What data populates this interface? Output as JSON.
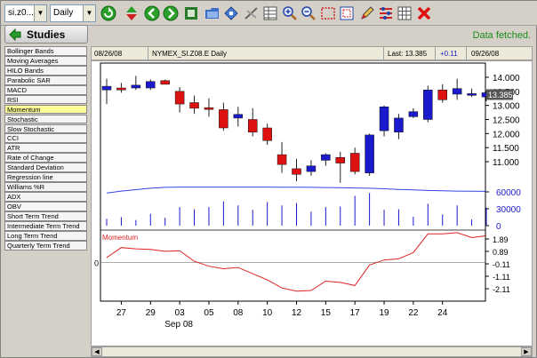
{
  "toolbar": {
    "symbol_value": "si.z0...",
    "period_value": "Daily",
    "icons": [
      "refresh-icon",
      "up-down-icon",
      "back-icon",
      "forward-icon",
      "print-icon",
      "open-folder-icon",
      "save-icon",
      "draw-line-icon",
      "table-icon",
      "zoom-in-icon",
      "zoom-out-icon",
      "select-rect-icon",
      "fit-icon",
      "pencil-icon",
      "settings-icon",
      "grid-icon",
      "delete-icon"
    ]
  },
  "status": "Data fetched.",
  "studies": {
    "button_label": "Studies",
    "items": [
      "Bollinger Bands",
      "Moving Averages",
      "HILO Bands",
      "Parabolic SAR",
      "MACD",
      "RSI",
      "Momentum",
      "Stochastic",
      "Slow Stochastic",
      "CCI",
      "ATR",
      "Rate of Change",
      "Standard Deviation",
      "Regression line",
      "Williams %R",
      "ADX",
      "OBV",
      "Short Term Trend",
      "Intermediate Term Trend",
      "Long Term Trend",
      "Quarterly Term Trend"
    ],
    "active_index": 6
  },
  "header": {
    "date_left": "08/26/08",
    "title": "NYMEX_SI.Z08.E Daily",
    "last_label": "Last: 13.385",
    "change": "+0.11",
    "date_right": "09/26/08"
  },
  "colors": {
    "up": "#1a1acc",
    "down": "#dd1111",
    "ma": "#3344dd",
    "momentum": "#dd2222",
    "status": "#1a8a1a"
  },
  "chart_data": {
    "type": "candlestick",
    "price_axis": {
      "ticks": [
        14.0,
        13.5,
        13.0,
        12.5,
        12.0,
        11.5,
        11.0
      ],
      "labels": [
        "14.000",
        "13.500",
        "13.000",
        "12.500",
        "12.000",
        "11.500",
        "11.000"
      ],
      "range": [
        10.5,
        14.4
      ]
    },
    "last_price_tag": "13.385",
    "volume_axis": {
      "ticks": [
        60000,
        30000,
        0
      ],
      "labels": [
        "60000",
        "30000",
        "0"
      ]
    },
    "momentum": {
      "label": "Momentum",
      "ticks": [
        1.89,
        0.89,
        -0.11,
        -1.11,
        -2.11
      ],
      "labels": [
        "1.89",
        "0.89",
        "-0.11",
        "-1.11",
        "-2.11"
      ],
      "zero_label": "0"
    },
    "x_labels": [
      "27",
      "29",
      "03",
      "05",
      "08",
      "10",
      "12",
      "15",
      "17",
      "19",
      "22",
      "24"
    ],
    "x_label_index": [
      1,
      3,
      5,
      7,
      9,
      11,
      13,
      15,
      17,
      19,
      21,
      23
    ],
    "month_label": "Sep 08",
    "candles": [
      {
        "o": 13.55,
        "h": 13.95,
        "l": 13.05,
        "c": 13.68
      },
      {
        "o": 13.62,
        "h": 13.8,
        "l": 13.45,
        "c": 13.55
      },
      {
        "o": 13.62,
        "h": 14.05,
        "l": 13.55,
        "c": 13.72
      },
      {
        "o": 13.62,
        "h": 13.92,
        "l": 13.55,
        "c": 13.85
      },
      {
        "o": 13.88,
        "h": 13.92,
        "l": 13.75,
        "c": 13.75
      },
      {
        "o": 13.5,
        "h": 13.65,
        "l": 12.75,
        "c": 13.05
      },
      {
        "o": 13.1,
        "h": 13.35,
        "l": 12.7,
        "c": 12.9
      },
      {
        "o": 12.92,
        "h": 13.25,
        "l": 12.6,
        "c": 12.9
      },
      {
        "o": 12.85,
        "h": 13.1,
        "l": 12.1,
        "c": 12.2
      },
      {
        "o": 12.55,
        "h": 12.95,
        "l": 12.25,
        "c": 12.68
      },
      {
        "o": 12.5,
        "h": 12.9,
        "l": 11.9,
        "c": 12.05
      },
      {
        "o": 12.2,
        "h": 12.35,
        "l": 11.6,
        "c": 11.75
      },
      {
        "o": 11.25,
        "h": 11.7,
        "l": 10.6,
        "c": 10.9
      },
      {
        "o": 10.75,
        "h": 11.1,
        "l": 10.3,
        "c": 10.55
      },
      {
        "o": 10.65,
        "h": 11.05,
        "l": 10.5,
        "c": 10.85
      },
      {
        "o": 11.05,
        "h": 11.3,
        "l": 10.85,
        "c": 11.25
      },
      {
        "o": 11.15,
        "h": 11.35,
        "l": 10.25,
        "c": 10.95
      },
      {
        "o": 11.3,
        "h": 11.5,
        "l": 10.55,
        "c": 10.65
      },
      {
        "o": 10.6,
        "h": 12.0,
        "l": 10.5,
        "c": 11.95
      },
      {
        "o": 12.1,
        "h": 13.0,
        "l": 11.9,
        "c": 12.95
      },
      {
        "o": 12.05,
        "h": 12.7,
        "l": 11.8,
        "c": 12.55
      },
      {
        "o": 12.6,
        "h": 12.9,
        "l": 12.55,
        "c": 12.78
      },
      {
        "o": 12.5,
        "h": 13.7,
        "l": 12.4,
        "c": 13.55
      },
      {
        "o": 13.55,
        "h": 13.75,
        "l": 13.1,
        "c": 13.2
      },
      {
        "o": 13.4,
        "h": 13.95,
        "l": 13.2,
        "c": 13.6
      },
      {
        "o": 13.42,
        "h": 13.6,
        "l": 13.3,
        "c": 13.42
      },
      {
        "o": 13.3,
        "h": 13.5,
        "l": 13.15,
        "c": 13.45
      }
    ],
    "moving_average": [
      58000,
      61500,
      64000,
      66500,
      68000,
      68500,
      68500,
      68500,
      68500,
      68500,
      68500,
      68500,
      68400,
      68200,
      68000,
      67800,
      67500,
      67000,
      66500,
      65500,
      64500,
      63500,
      62500,
      62000,
      61500,
      61200,
      61000
    ],
    "volume": [
      12000,
      15000,
      10000,
      21000,
      14000,
      33000,
      29000,
      33000,
      43000,
      36000,
      28000,
      42000,
      36000,
      40000,
      25000,
      33000,
      34000,
      53000,
      58000,
      28000,
      29000,
      16000,
      39000,
      20000,
      36000,
      11000,
      32000
    ],
    "momentum_values": [
      0.4,
      1.2,
      1.1,
      1.05,
      0.9,
      0.95,
      0.1,
      -0.3,
      -0.5,
      -0.4,
      -0.9,
      -1.4,
      -2.05,
      -2.3,
      -2.25,
      -1.5,
      -1.6,
      -1.85,
      -0.2,
      0.2,
      0.3,
      0.8,
      2.3,
      2.3,
      2.4,
      2.0,
      2.15
    ]
  }
}
